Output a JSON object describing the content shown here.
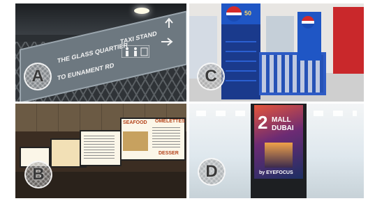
{
  "panels": {
    "a": {
      "badge": "A",
      "sign_lines": [
        "THE GLASS QUARTIER",
        "TO EUNAMENT RD",
        "TAXI STAND"
      ]
    },
    "c": {
      "badge": "C",
      "pepsi_badge": "50"
    },
    "b": {
      "badge": "B",
      "menu_headings": [
        "SEAFOOD",
        "OMELETTES",
        "DESSER"
      ]
    },
    "d": {
      "badge": "D",
      "screen_line1": "2",
      "screen_line2": "MALL",
      "screen_line3": "DUBAI",
      "brand": "by EYEFOCUS"
    }
  },
  "colors": {
    "sign_panel": "#6d7880",
    "pepsi_blue": "#1a3a8c",
    "menu_board": "#fbf6e8",
    "kiosk_screen": "#e4553a"
  }
}
